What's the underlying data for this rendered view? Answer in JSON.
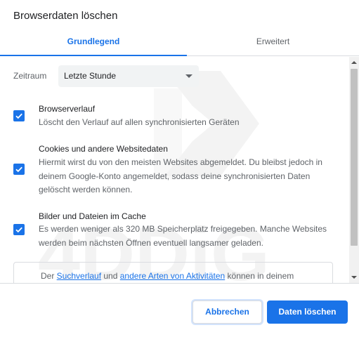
{
  "dialog": {
    "title": "Browserdaten löschen"
  },
  "tabs": [
    {
      "label": "Grundlegend",
      "active": true
    },
    {
      "label": "Erweitert",
      "active": false
    }
  ],
  "time_range": {
    "label": "Zeitraum",
    "selected": "Letzte Stunde"
  },
  "options": [
    {
      "title": "Browserverlauf",
      "description": "Löscht den Verlauf auf allen synchronisierten Geräten",
      "checked": true
    },
    {
      "title": "Cookies und andere Websitedaten",
      "description": "Hiermit wirst du von den meisten Websites abgemeldet. Du bleibst jedoch in deinem Google-Konto angemeldet, sodass deine synchronisierten Daten gelöscht werden können.",
      "checked": true
    },
    {
      "title": "Bilder und Dateien im Cache",
      "description": "Es werden weniger als 320 MB Speicherplatz freigegeben. Manche Websites werden beim nächsten Öffnen eventuell langsamer geladen.",
      "checked": true
    }
  ],
  "info": {
    "prefix": "Der ",
    "link1": "Suchverlauf",
    "middle": " und ",
    "link2": "andere Arten von Aktivitäten",
    "suffix": " können in deinem"
  },
  "watermark": {
    "text": "4DDiG"
  },
  "footer": {
    "cancel_label": "Abbrechen",
    "clear_label": "Daten löschen"
  },
  "colors": {
    "accent": "#1a73e8",
    "text": "#202124",
    "secondary_text": "#5f6368",
    "divider": "#dadce0"
  },
  "icons": {
    "checkbox": "check-icon",
    "select": "caret-down-icon"
  }
}
